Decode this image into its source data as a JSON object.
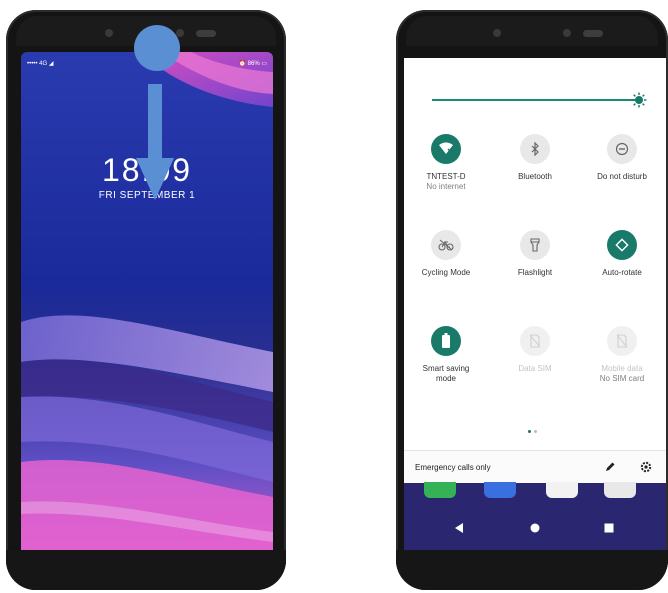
{
  "lock_screen": {
    "status_left": "••••• 4G ◢",
    "status_right": "⏰ 86% ▭",
    "time": "18:09",
    "date": "FRI SEPTEMBER 1"
  },
  "quick_settings": {
    "tiles": [
      {
        "label": "TNTEST-D",
        "sublabel": "No internet",
        "icon": "wifi-off-icon",
        "state": "on"
      },
      {
        "label": "Bluetooth",
        "sublabel": "",
        "icon": "bluetooth-icon",
        "state": "off"
      },
      {
        "label": "Do not disturb",
        "sublabel": "",
        "icon": "do-not-disturb-icon",
        "state": "off"
      },
      {
        "label": "Cycling Mode",
        "sublabel": "",
        "icon": "bicycle-icon",
        "state": "off"
      },
      {
        "label": "Flashlight",
        "sublabel": "",
        "icon": "flashlight-icon",
        "state": "off"
      },
      {
        "label": "Auto-rotate",
        "sublabel": "",
        "icon": "auto-rotate-icon",
        "state": "on"
      },
      {
        "label": "Smart saving mode",
        "sublabel": "",
        "icon": "battery-icon",
        "state": "on"
      },
      {
        "label": "Data SIM",
        "sublabel": "",
        "icon": "sim-off-icon",
        "state": "disabled"
      },
      {
        "label": "Mobile data",
        "sublabel": "No SIM card",
        "icon": "sim-off-icon",
        "state": "disabled"
      }
    ],
    "footer_text": "Emergency calls only"
  },
  "colors": {
    "accent": "#197a6a",
    "touch_indicator": "#5b8fd3"
  }
}
